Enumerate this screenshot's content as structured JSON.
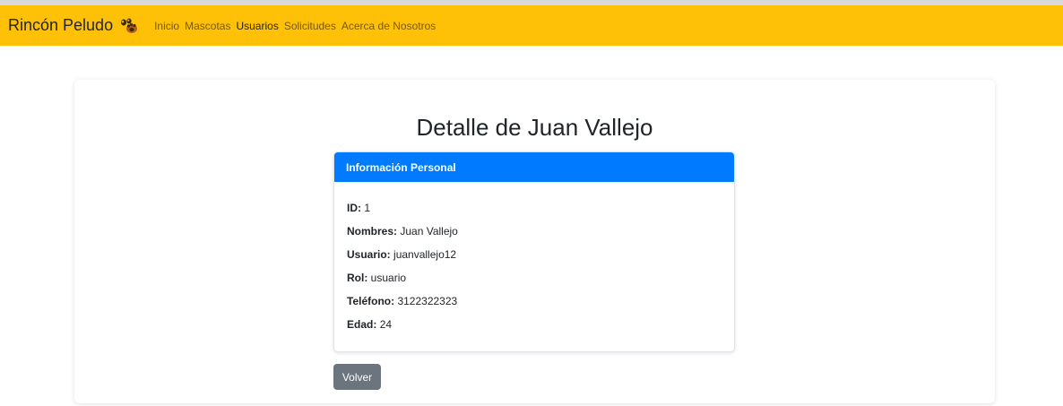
{
  "navbar": {
    "brand": "Rincón Peludo",
    "brand_icon": "paw-icon",
    "links": [
      {
        "label": "Inicio",
        "active": false
      },
      {
        "label": "Mascotas",
        "active": false
      },
      {
        "label": "Usuarios",
        "active": true
      },
      {
        "label": "Solicitudes",
        "active": false
      },
      {
        "label": "Acerca de Nosotros",
        "active": false
      }
    ],
    "bg_color": "#ffc107"
  },
  "main": {
    "title": "Detalle de Juan Vallejo",
    "card": {
      "header": "Información Personal",
      "header_color": "#007bff",
      "fields": [
        {
          "label": "ID:",
          "value": "1"
        },
        {
          "label": "Nombres:",
          "value": "Juan Vallejo"
        },
        {
          "label": "Usuario:",
          "value": "juanvallejo12"
        },
        {
          "label": "Rol:",
          "value": "usuario"
        },
        {
          "label": "Teléfono:",
          "value": "3122322323"
        },
        {
          "label": "Edad:",
          "value": "24"
        }
      ]
    },
    "back_button": "Volver",
    "back_button_color": "#6c757d"
  }
}
